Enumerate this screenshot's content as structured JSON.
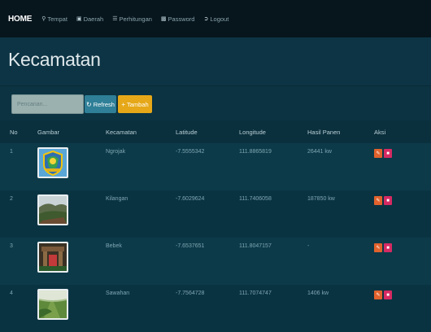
{
  "nav": {
    "brand": "HOME",
    "items": [
      {
        "label": "Tempat",
        "icon": "map-marker-icon"
      },
      {
        "label": "Daerah",
        "icon": "picture-icon"
      },
      {
        "label": "Perhitungan",
        "icon": "list-icon"
      },
      {
        "label": "Password",
        "icon": "lock-icon"
      },
      {
        "label": "Logout",
        "icon": "logout-icon"
      }
    ]
  },
  "page": {
    "title": "Kecamatan"
  },
  "toolbar": {
    "search_placeholder": "Pencarian...",
    "refresh_label": "Refresh",
    "add_label": "Tambah"
  },
  "table": {
    "headers": [
      "No",
      "Gambar",
      "Kecamatan",
      "Latitude",
      "Longitude",
      "Hasil Panen",
      "Aksi"
    ],
    "rows": [
      {
        "no": "1",
        "kecamatan": "Ngrojak",
        "latitude": "-7.5555342",
        "longitude": "111.8865819",
        "hasil_panen": "26441 kw",
        "image": "emblem"
      },
      {
        "no": "2",
        "kecamatan": "Kilangan",
        "latitude": "-7.6029624",
        "longitude": "111.7406058",
        "hasil_panen": "187850 kw",
        "image": "hills"
      },
      {
        "no": "3",
        "kecamatan": "Bebek",
        "latitude": "-7.6537651",
        "longitude": "111.8047157",
        "hasil_panen": "-",
        "image": "gate"
      },
      {
        "no": "4",
        "kecamatan": "Sawahan",
        "latitude": "-7.7564728",
        "longitude": "111.7074747",
        "hasil_panen": "1406 kw",
        "image": "field"
      }
    ]
  },
  "colors": {
    "navbar": "#07151d",
    "background": "#0c3a49",
    "refresh": "#2e7f97",
    "add": "#e6a818",
    "edit": "#e1622c",
    "delete": "#d62a63"
  }
}
